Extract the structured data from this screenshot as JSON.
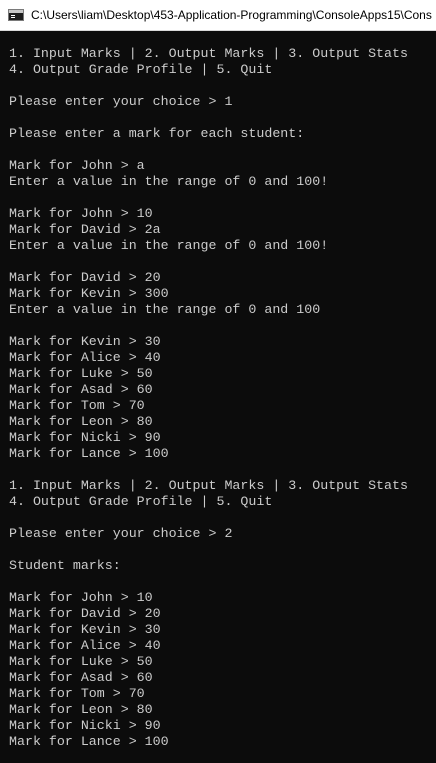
{
  "window": {
    "title": "C:\\Users\\liam\\Desktop\\453-Application-Programming\\ConsoleApps15\\Cons",
    "icon": "console-app-icon"
  },
  "colors": {
    "background": "#0c0c0c",
    "foreground": "#cccccc",
    "titlebar": "#ffffff"
  },
  "console": {
    "lines": [
      "1. Input Marks | 2. Output Marks | 3. Output Stats",
      "4. Output Grade Profile | 5. Quit",
      "",
      "Please enter your choice > 1",
      "",
      "Please enter a mark for each student:",
      "",
      "Mark for John > a",
      "Enter a value in the range of 0 and 100!",
      "",
      "Mark for John > 10",
      "Mark for David > 2a",
      "Enter a value in the range of 0 and 100!",
      "",
      "Mark for David > 20",
      "Mark for Kevin > 300",
      "Enter a value in the range of 0 and 100",
      "",
      "Mark for Kevin > 30",
      "Mark for Alice > 40",
      "Mark for Luke > 50",
      "Mark for Asad > 60",
      "Mark for Tom > 70",
      "Mark for Leon > 80",
      "Mark for Nicki > 90",
      "Mark for Lance > 100",
      "",
      "1. Input Marks | 2. Output Marks | 3. Output Stats",
      "4. Output Grade Profile | 5. Quit",
      "",
      "Please enter your choice > 2",
      "",
      "Student marks:",
      "",
      "Mark for John > 10",
      "Mark for David > 20",
      "Mark for Kevin > 30",
      "Mark for Alice > 40",
      "Mark for Luke > 50",
      "Mark for Asad > 60",
      "Mark for Tom > 70",
      "Mark for Leon > 80",
      "Mark for Nicki > 90",
      "Mark for Lance > 100"
    ]
  }
}
